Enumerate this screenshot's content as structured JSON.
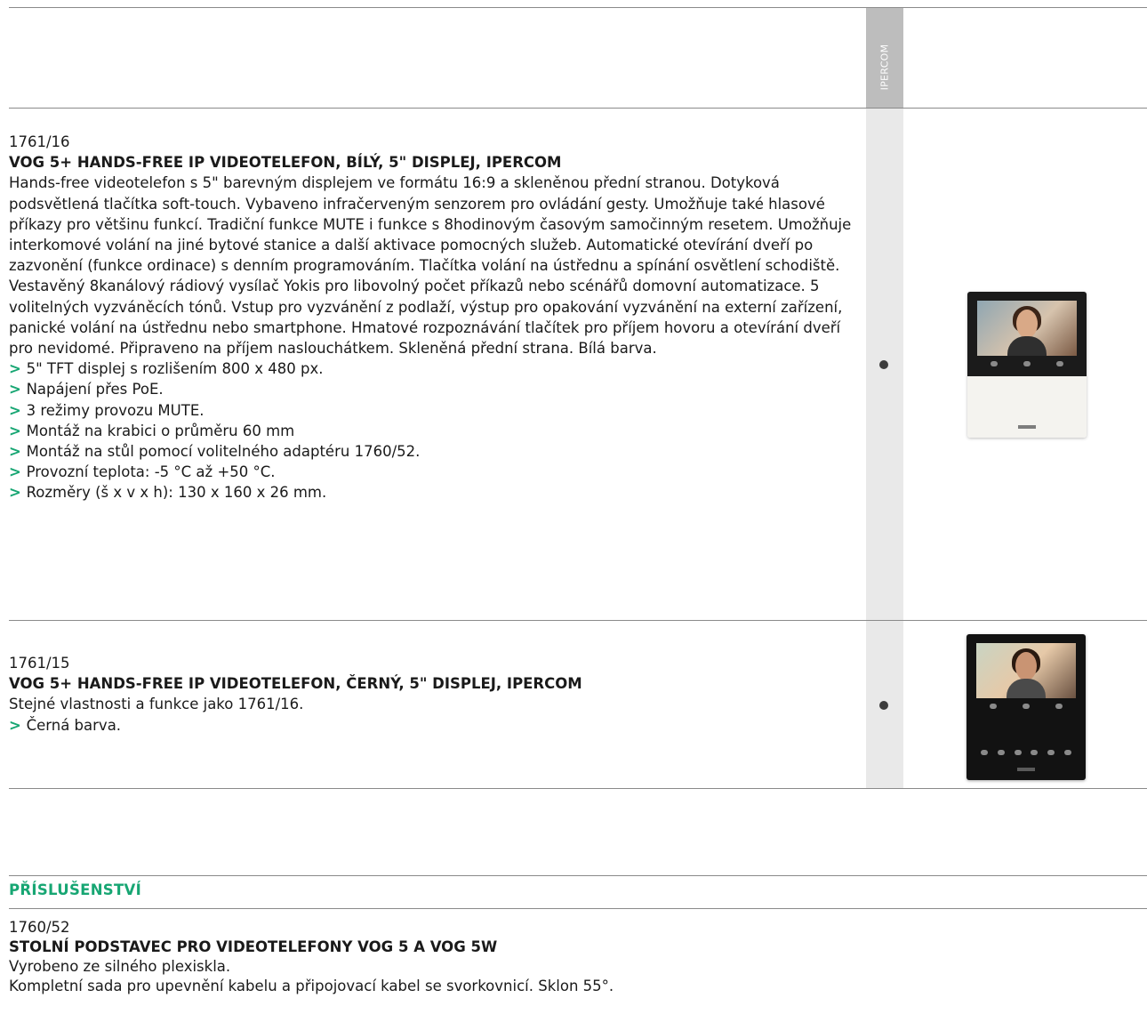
{
  "side_label": "IPERCOM",
  "products": [
    {
      "code": "1761/16",
      "title": "VOG 5+ HANDS-FREE IP VIDEOTELEFON, BÍLÝ, 5\" DISPLEJ, IPERCOM",
      "description": "Hands-free videotelefon s 5\" barevným displejem ve formátu 16:9 a skleněnou přední stranou. Dotyková podsvětlená tlačítka soft-touch. Vybaveno infračerveným senzorem pro ovládání gesty. Umožňuje také hlasové příkazy pro většinu funkcí. Tradiční funkce MUTE i funkce s 8hodinovým časovým samočinným resetem. Umožňuje interkomové volání na jiné bytové stanice a další aktivace pomocných služeb. Automatické otevírání dveří po zazvonění (funkce ordinace) s denním programováním. Tlačítka volání na ústřednu a spínání osvětlení schodiště. Vestavěný 8kanálový rádiový vysílač Yokis pro libovolný počet příkazů nebo scénářů domovní automatizace. 5 volitelných vyzváněcích tónů. Vstup pro vyzvánění z podlaží, výstup pro opakování vyzvánění na externí zařízení, panické volání na ústřednu nebo smartphone. Hmatové rozpoznávání tlačítek pro příjem hovoru a otevírání dveří pro nevidomé. Připraveno na příjem naslouchátkem. Skleněná přední strana. Bílá barva.",
      "features": [
        "5\" TFT displej s rozlišením 800 x 480 px.",
        "Napájení přes PoE.",
        "3 režimy provozu MUTE.",
        "Montáž na krabici o průměru 60 mm",
        "Montáž na stůl pomocí volitelného adaptéru 1760/52.",
        "Provozní teplota: -5 °C až +50 °C.",
        "Rozměry (š x v x h): 130 x 160 x 26 mm."
      ]
    },
    {
      "code": "1761/15",
      "title": "VOG 5+ HANDS-FREE IP VIDEOTELEFON, ČERNÝ, 5\" DISPLEJ, IPERCOM",
      "description": "Stejné vlastnosti a funkce jako 1761/16.",
      "features": [
        "Černá barva."
      ]
    }
  ],
  "accessories": {
    "section_title": "PŘÍSLUŠENSTVÍ",
    "item": {
      "code": "1760/52",
      "title": "STOLNÍ PODSTAVEC PRO VIDEOTELEFONY VOG 5 A VOG 5W",
      "lines": [
        "Vyrobeno ze silného plexiskla.",
        "Kompletní sada pro upevnění kabelu a připojovací kabel se svorkovnicí. Sklon 55°."
      ]
    }
  },
  "colors": {
    "accent": "#17a673",
    "band": "#e9e9e9",
    "rule": "#8a8a8a"
  }
}
